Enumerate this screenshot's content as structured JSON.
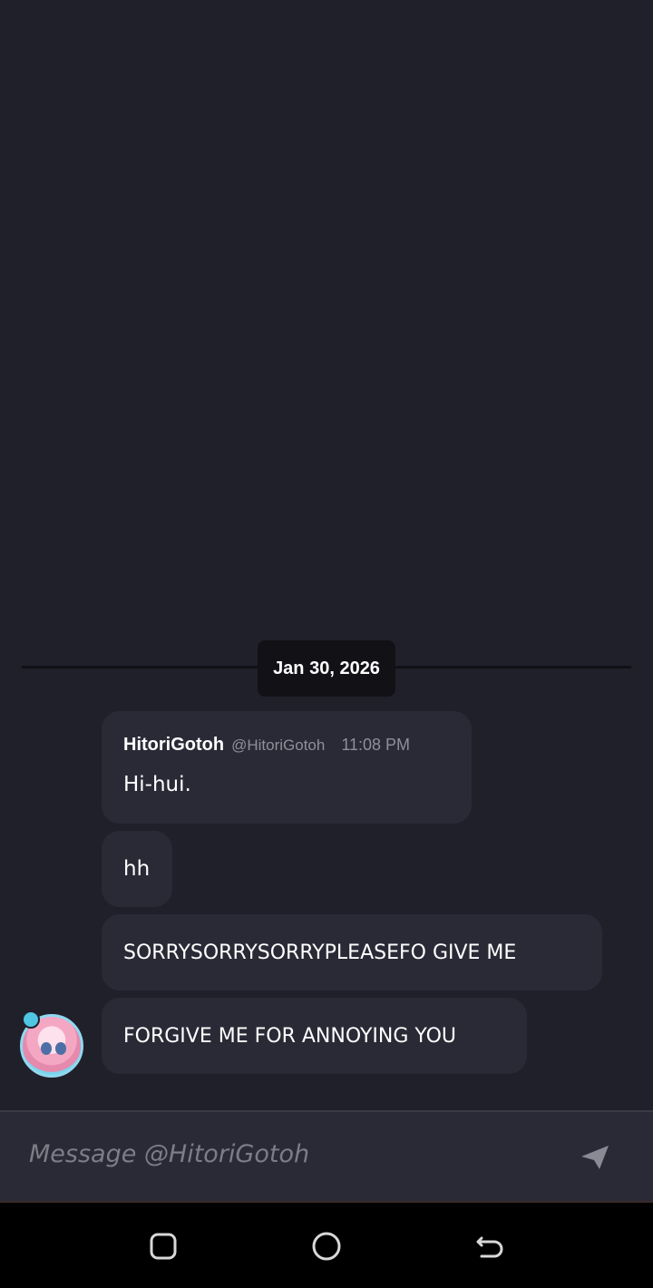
{
  "date_divider": {
    "label": "Jan 30, 2026"
  },
  "messages": [
    {
      "author": "HitoriGotoh",
      "handle": "@HitoriGotoh",
      "time": "11:08 PM",
      "text": "Hi-hui."
    },
    {
      "text": "hh"
    },
    {
      "text": "SORRYSORRYSORRYPLEASEFO GIVE ME"
    },
    {
      "text": "FORGIVE ME FOR ANNOYING YOU"
    }
  ],
  "avatar": {
    "icon": "user-avatar-icon"
  },
  "composer": {
    "placeholder": "Message @HitoriGotoh",
    "send_icon": "send-icon"
  },
  "navbar": {
    "recents_icon": "recents-icon",
    "home_icon": "home-icon",
    "back_icon": "back-icon"
  },
  "colors": {
    "background": "#20202b",
    "bubble": "#2a2a37",
    "date_pill": "#111116",
    "muted_text": "#8f8f9a"
  }
}
